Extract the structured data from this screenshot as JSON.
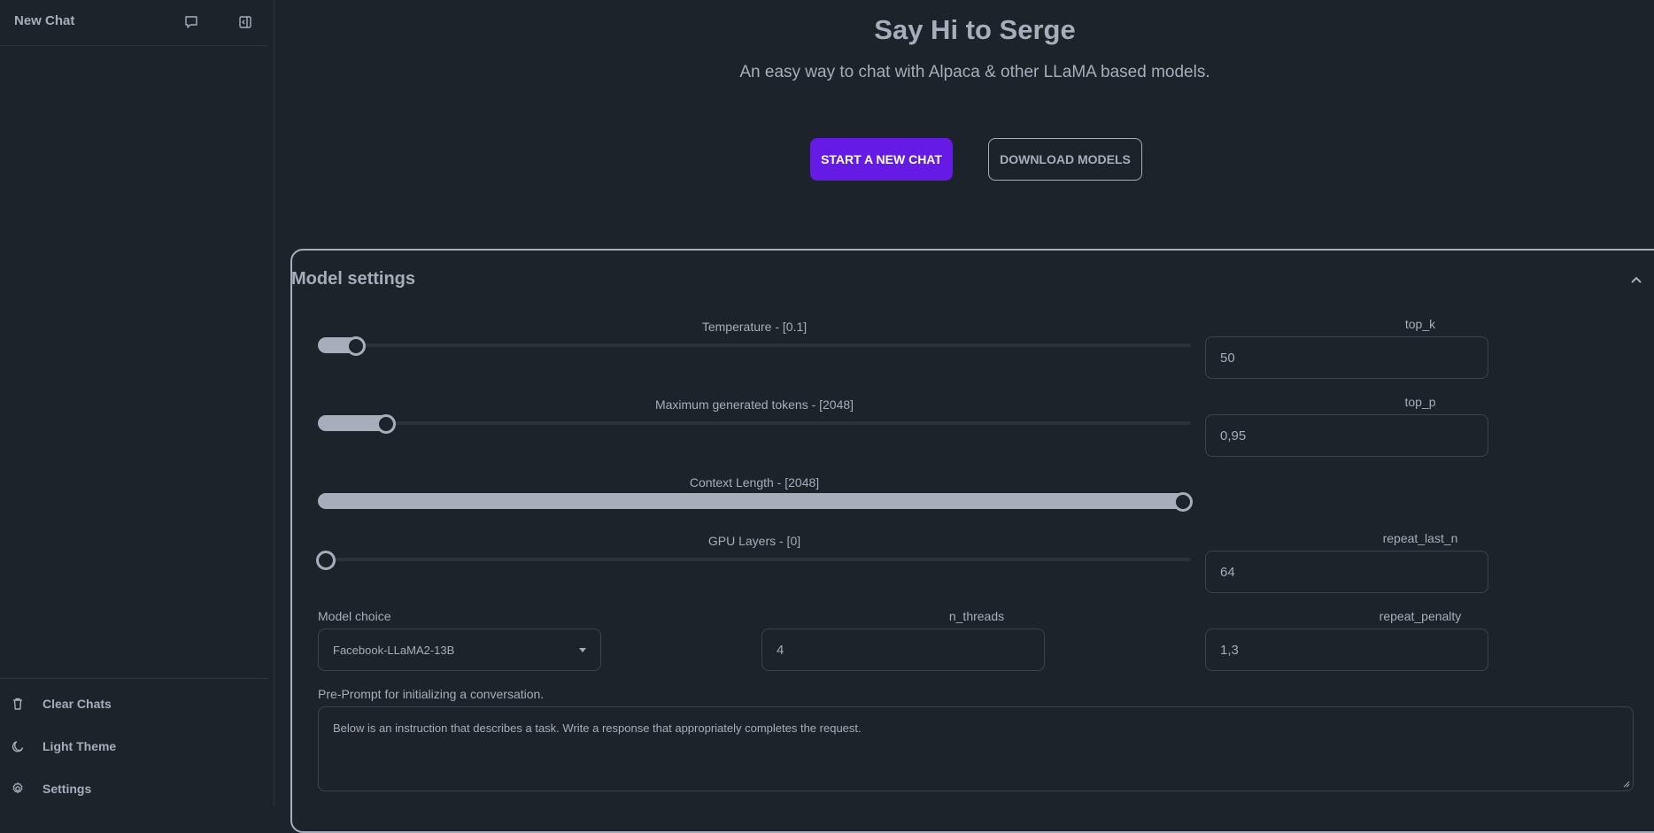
{
  "sidebar": {
    "title": "New Chat",
    "icons": {
      "new_chat": "chat-bubble-icon",
      "collapse": "sidebar-collapse-icon"
    },
    "bottom_items": [
      {
        "label": "Clear Chats",
        "icon": "trash-icon"
      },
      {
        "label": "Light Theme",
        "icon": "moon-icon"
      },
      {
        "label": "Settings",
        "icon": "gear-icon"
      }
    ]
  },
  "hero": {
    "title": "Say Hi to Serge",
    "subtitle": "An easy way to chat with Alpaca & other LLaMA based models."
  },
  "actions": {
    "start_label": "START A NEW CHAT",
    "download_label": "DOWNLOAD MODELS"
  },
  "settings": {
    "title": "Model settings",
    "sliders": {
      "temperature": {
        "label": "Temperature - [0.1]",
        "value": 0.1,
        "level": 0.035
      },
      "max_tokens": {
        "label": "Maximum generated tokens - [2048]",
        "value": 2048,
        "level": 0.07
      },
      "context_length": {
        "label": "Context Length - [2048]",
        "value": 2048,
        "level": 1.0
      },
      "gpu_layers": {
        "label": "GPU Layers - [0]",
        "value": 0,
        "level": 0
      }
    },
    "fields": {
      "top_k": {
        "label": "top_k",
        "value": "50"
      },
      "top_p": {
        "label": "top_p",
        "value": "0,95"
      },
      "repeat_last_n": {
        "label": "repeat_last_n",
        "value": "64"
      },
      "model_choice": {
        "label": "Model choice",
        "value": "Facebook-LLaMA2-13B"
      },
      "n_threads": {
        "label": "n_threads",
        "value": "4"
      },
      "repeat_penalty": {
        "label": "repeat_penalty",
        "value": "1,3"
      }
    },
    "preprompt": {
      "label": "Pre-Prompt for initializing a conversation.",
      "value": "Below is an instruction that describes a task. Write a response that appropriately completes the request."
    }
  },
  "colors": {
    "background": "#1d232a",
    "text": "#a6adbb",
    "primary": "#661ae6"
  }
}
